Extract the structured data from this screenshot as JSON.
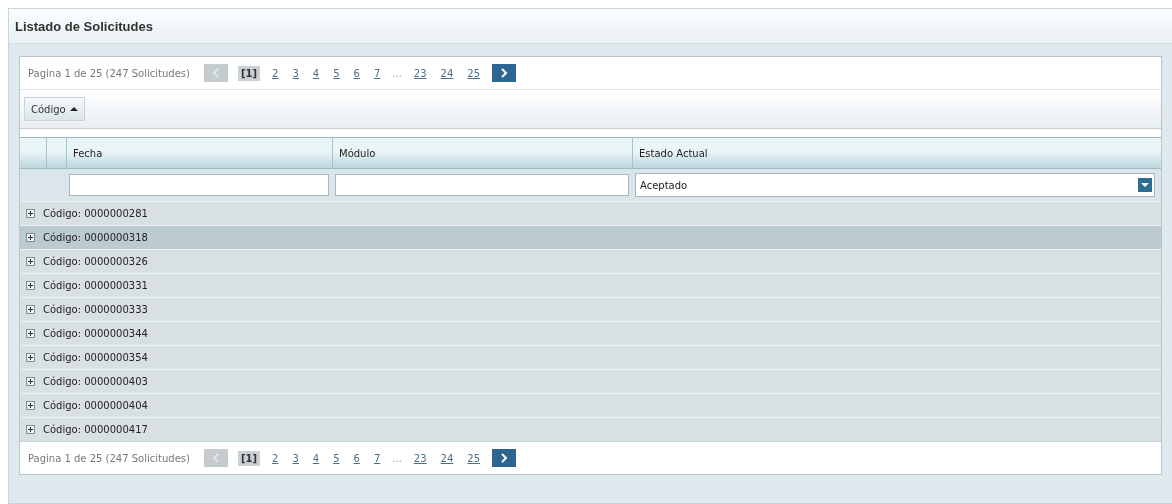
{
  "panel": {
    "title": "Listado de Solicitudes"
  },
  "pager_top": {
    "summary": "Pagina 1 de 25 (247 Solicitudes)",
    "prev_disabled": true,
    "pages": [
      {
        "label": "[1]",
        "selected": true,
        "kind": "page"
      },
      {
        "label": "2",
        "selected": false,
        "kind": "page"
      },
      {
        "label": "3",
        "selected": false,
        "kind": "page"
      },
      {
        "label": "4",
        "selected": false,
        "kind": "page"
      },
      {
        "label": "5",
        "selected": false,
        "kind": "page"
      },
      {
        "label": "6",
        "selected": false,
        "kind": "page"
      },
      {
        "label": "7",
        "selected": false,
        "kind": "page"
      },
      {
        "label": "...",
        "selected": false,
        "kind": "ellipsis"
      },
      {
        "label": "23",
        "selected": false,
        "kind": "page"
      },
      {
        "label": "24",
        "selected": false,
        "kind": "page"
      },
      {
        "label": "25",
        "selected": false,
        "kind": "page"
      }
    ]
  },
  "group_panel": {
    "label": "Código",
    "sorted_ascending": true
  },
  "table": {
    "columns": [
      "Fecha",
      "Módulo",
      "Estado Actual"
    ],
    "filters": [
      {
        "kind": "text"
      },
      {
        "kind": "text"
      },
      {
        "kind": "combo",
        "value": "Aceptado"
      }
    ],
    "groups": [
      {
        "label": "Código: 0000000281",
        "selected": false
      },
      {
        "label": "Código: 0000000318",
        "selected": true
      },
      {
        "label": "Código: 0000000326",
        "selected": false
      },
      {
        "label": "Código: 0000000331",
        "selected": false
      },
      {
        "label": "Código: 0000000333",
        "selected": false
      },
      {
        "label": "Código: 0000000344",
        "selected": false
      },
      {
        "label": "Código: 0000000354",
        "selected": false
      },
      {
        "label": "Código: 0000000403",
        "selected": false
      },
      {
        "label": "Código: 0000000404",
        "selected": false
      },
      {
        "label": "Código: 0000000417",
        "selected": false
      }
    ]
  },
  "pager_bottom": {
    "summary": "Pagina 1 de 25 (247 Solicitudes)",
    "prev_disabled": true,
    "pages": [
      {
        "label": "[1]",
        "selected": true,
        "kind": "page"
      },
      {
        "label": "2",
        "selected": false,
        "kind": "page"
      },
      {
        "label": "3",
        "selected": false,
        "kind": "page"
      },
      {
        "label": "4",
        "selected": false,
        "kind": "page"
      },
      {
        "label": "5",
        "selected": false,
        "kind": "page"
      },
      {
        "label": "6",
        "selected": false,
        "kind": "page"
      },
      {
        "label": "7",
        "selected": false,
        "kind": "page"
      },
      {
        "label": "...",
        "selected": false,
        "kind": "ellipsis"
      },
      {
        "label": "23",
        "selected": false,
        "kind": "page"
      },
      {
        "label": "24",
        "selected": false,
        "kind": "page"
      },
      {
        "label": "25",
        "selected": false,
        "kind": "page"
      }
    ]
  }
}
